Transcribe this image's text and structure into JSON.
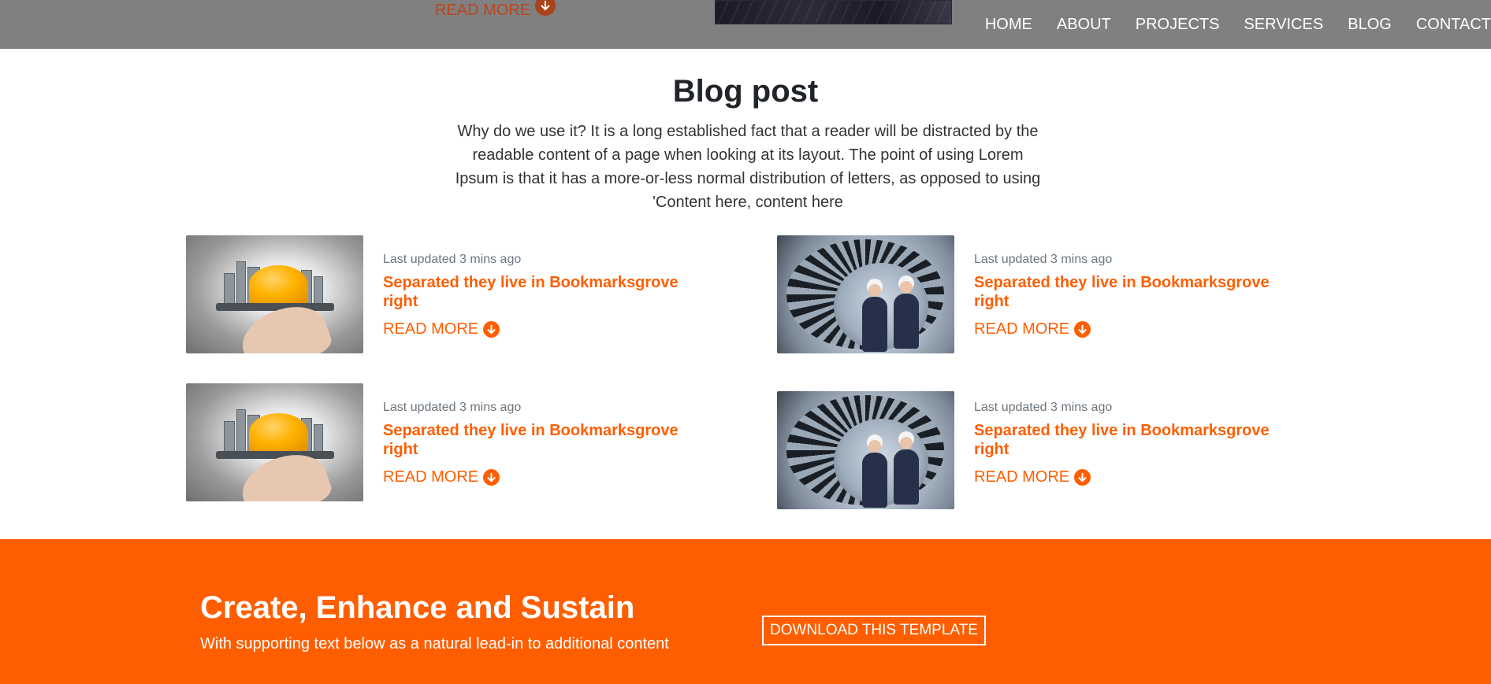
{
  "previous_section": {
    "read_more_label": "READ MORE"
  },
  "nav": {
    "items": [
      "HOME",
      "ABOUT",
      "PROJECTS",
      "SERVICES",
      "BLOG",
      "CONTACT"
    ]
  },
  "blog": {
    "title": "Blog post",
    "intro": "Why do we use it? It is a long established fact that a reader will be distracted by the readable content of a page when looking at its layout. The point of using Lorem Ipsum is that it has a more-or-less normal distribution of letters, as opposed to using 'Content here, content here",
    "posts": [
      {
        "updated": "Last updated 3 mins ago",
        "title": "Separated they live in Bookmarksgrove right",
        "read_more": "READ MORE",
        "image": "helmet-on-hand"
      },
      {
        "updated": "Last updated 3 mins ago",
        "title": "Separated they live in Bookmarksgrove right",
        "read_more": "READ MORE",
        "image": "engineers-in-gear"
      },
      {
        "updated": "Last updated 3 mins ago",
        "title": "Separated they live in Bookmarksgrove right",
        "read_more": "READ MORE",
        "image": "helmet-on-hand"
      },
      {
        "updated": "Last updated 3 mins ago",
        "title": "Separated they live in Bookmarksgrove right",
        "read_more": "READ MORE",
        "image": "engineers-in-gear"
      }
    ]
  },
  "cta": {
    "heading": "Create, Enhance and Sustain",
    "subtext": "With supporting text below as a natural lead-in to additional content",
    "button": "DOWNLOAD THIS TEMPLATE"
  },
  "colors": {
    "accent": "#ff5e00",
    "nav_background": "#808080",
    "text": "#212529",
    "muted": "#6c757d"
  }
}
